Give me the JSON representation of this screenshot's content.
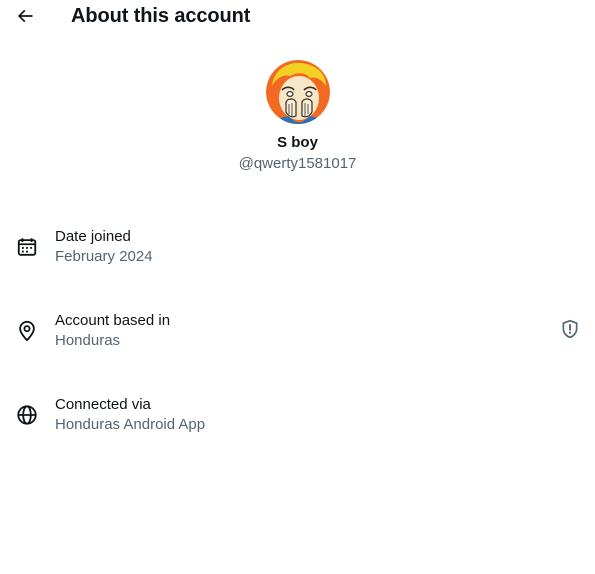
{
  "header": {
    "title": "About this account",
    "back_icon": "arrow-left-icon"
  },
  "profile": {
    "display_name": "S boy",
    "handle": "@qwerty1581017",
    "avatar_colors": {
      "background": "#f26a21",
      "hair": "#f2d024",
      "skin": "#f6e7c8"
    }
  },
  "info": {
    "date_joined": {
      "icon": "calendar-icon",
      "label": "Date joined",
      "value": "February 2024"
    },
    "account_based_in": {
      "icon": "location-pin-icon",
      "label": "Account based in",
      "value": "Honduras",
      "action_icon": "shield-alert-icon"
    },
    "connected_via": {
      "icon": "globe-icon",
      "label": "Connected via",
      "value": "Honduras Android App"
    }
  },
  "colors": {
    "primary_text": "#0f1419",
    "secondary_text": "#536471"
  }
}
